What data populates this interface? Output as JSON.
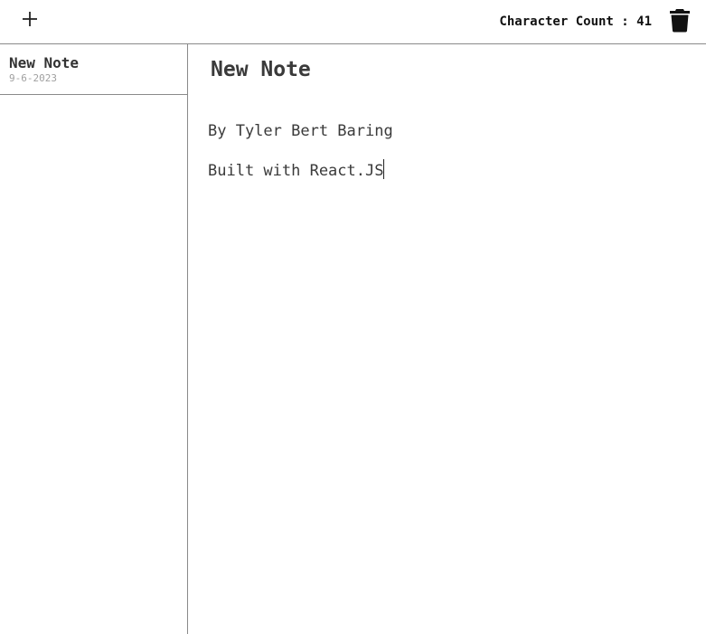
{
  "toolbar": {
    "add_icon": "plus-icon",
    "character_count_label": "Character Count : 41",
    "delete_icon": "trash-icon"
  },
  "sidebar": {
    "notes": [
      {
        "title": "New Note",
        "date": "9-6-2023"
      }
    ]
  },
  "editor": {
    "title": "New Note",
    "lines": [
      "By Tyler Bert Baring",
      "Built with React.JS"
    ]
  }
}
